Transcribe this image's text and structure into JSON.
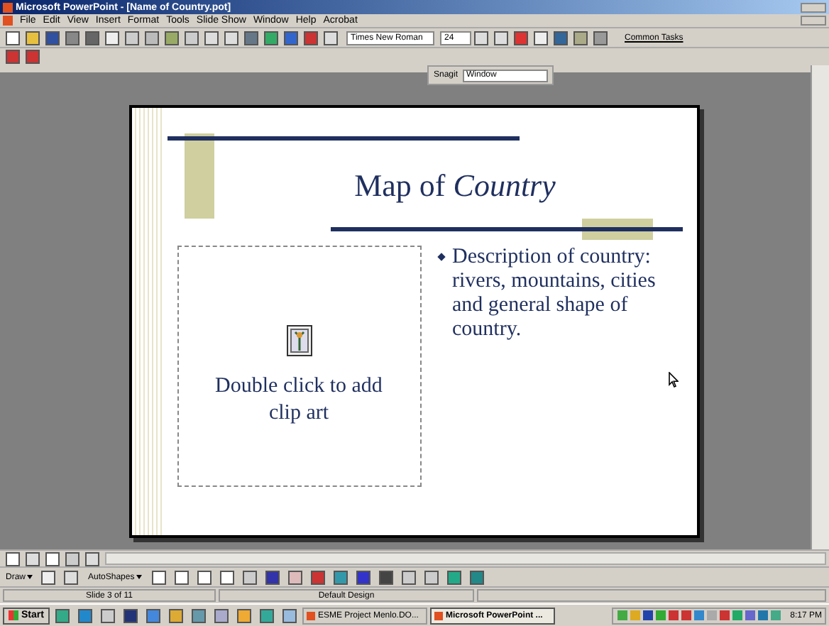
{
  "window": {
    "title": "Microsoft PowerPoint - [Name of Country.pot]"
  },
  "menu": [
    "File",
    "Edit",
    "View",
    "Insert",
    "Format",
    "Tools",
    "Slide Show",
    "Window",
    "Help",
    "Acrobat"
  ],
  "formatting": {
    "font": "Times New Roman",
    "size": "24",
    "common_tasks": "Common Tasks"
  },
  "snagit": {
    "label": "Snagit",
    "target": "Window"
  },
  "slide": {
    "title": "Map of *Country*",
    "clip_art_hint": "Double click to add clip art",
    "bullets": [
      "Description of country: rivers, mountains, cities and general shape of country."
    ]
  },
  "draw_toolbar": {
    "draw": "Draw",
    "autoshapes": "AutoShapes"
  },
  "status_bar": [
    "Slide 3 of 11",
    "Default Design"
  ],
  "taskbar": {
    "start": "Start",
    "tasks": [
      {
        "label": "ESME Project Menlo.DO...",
        "selected": false
      },
      {
        "label": "Microsoft PowerPoint ...",
        "selected": true
      }
    ],
    "clock": "8:17 PM"
  }
}
